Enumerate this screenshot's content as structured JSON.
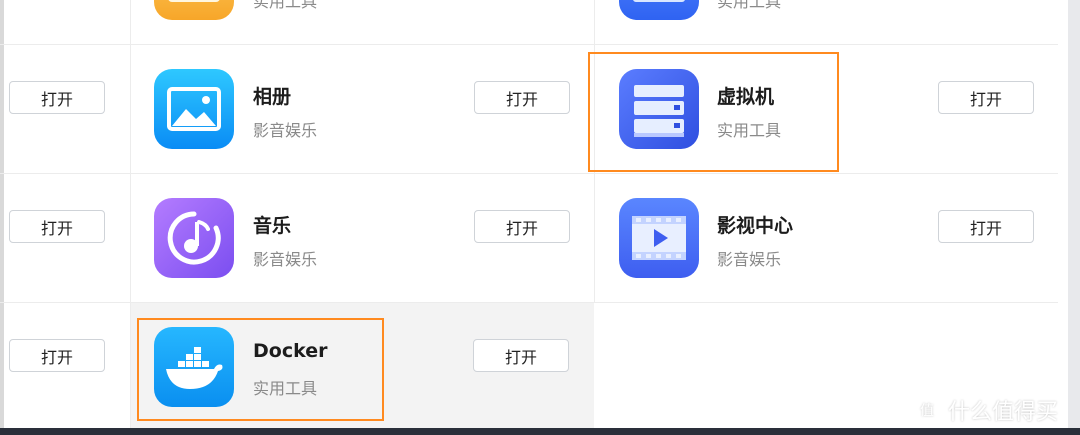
{
  "apps": {
    "top_left": {
      "category": "实用工具"
    },
    "top_right": {
      "category": "实用工具"
    },
    "photos": {
      "name": "相册",
      "category": "影音娱乐",
      "button": "打开"
    },
    "vm": {
      "name": "虚拟机",
      "category": "实用工具",
      "button": "打开"
    },
    "music": {
      "name": "音乐",
      "category": "影音娱乐",
      "button": "打开"
    },
    "video": {
      "name": "影视中心",
      "category": "影音娱乐",
      "button": "打开"
    },
    "docker": {
      "name": "Docker",
      "category": "实用工具",
      "button": "打开"
    }
  },
  "left_buttons": {
    "row1": "打开",
    "row2": "打开",
    "row3": "打开"
  },
  "colors": {
    "highlight": "#ff8a1f",
    "button_border": "#cfd3d8"
  },
  "watermark": {
    "text": "什么值得买"
  }
}
